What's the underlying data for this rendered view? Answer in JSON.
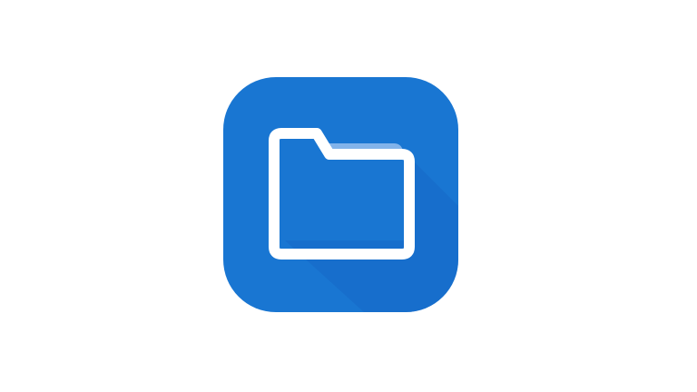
{
  "app_icon": {
    "icon": "folder-icon",
    "colors": {
      "background": "#1976d2",
      "folder_outline": "#ffffff",
      "folder_tab_highlight": "#82b3ea",
      "long_shadow": "#1565c0"
    }
  }
}
